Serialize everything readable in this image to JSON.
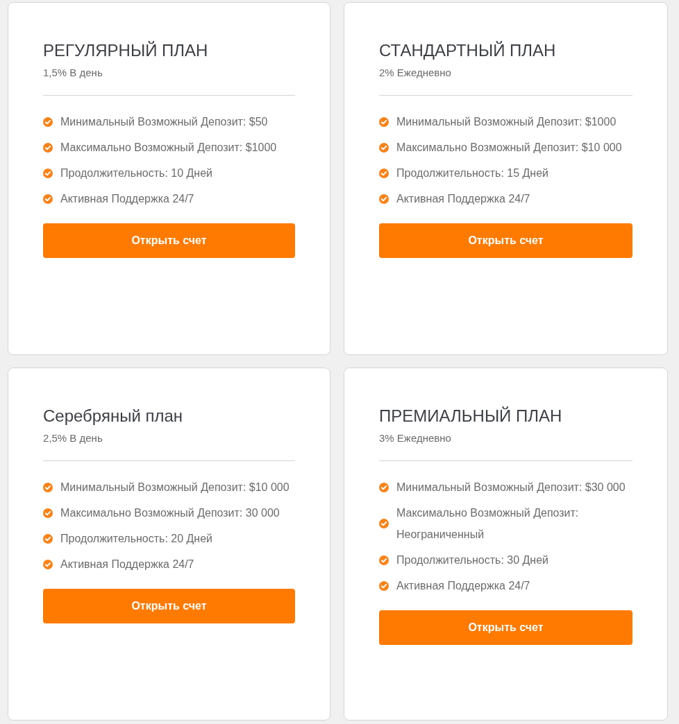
{
  "plans": [
    {
      "title": "РЕГУЛЯРНЫЙ ПЛАН",
      "rate": "1,5% В день",
      "features": [
        "Минимальный Возможный Депозит: $50",
        "Максимально Возможный Депозит: $1000",
        "Продолжительность: 10 Дней",
        "Активная Поддержка 24/7"
      ],
      "button": "Открыть счет"
    },
    {
      "title": "СТАНДАРТНЫЙ ПЛАН",
      "rate": "2% Ежедневно",
      "features": [
        "Минимальный Возможный Депозит: $1000",
        "Максимально Возможный Депозит: $10 000",
        "Продолжительность: 15 Дней",
        "Активная Поддержка 24/7"
      ],
      "button": "Открыть счет"
    },
    {
      "title": "Серебряный план",
      "rate": "2,5% В день",
      "features": [
        "Минимальный Возможный Депозит: $10 000",
        "Максимально Возможный Депозит: 30 000",
        "Продолжительность: 20 Дней",
        "Активная Поддержка 24/7"
      ],
      "button": "Открыть счет"
    },
    {
      "title": "ПРЕМИАЛЬНЫЙ ПЛАН",
      "rate": "3% Ежедневно",
      "features": [
        "Минимальный Возможный Депозит: $30 000",
        "Максимально Возможный Депозит: Неограниченный",
        "Продолжительность: 30 Дней",
        "Активная Поддержка 24/7"
      ],
      "button": "Открыть счет"
    }
  ]
}
